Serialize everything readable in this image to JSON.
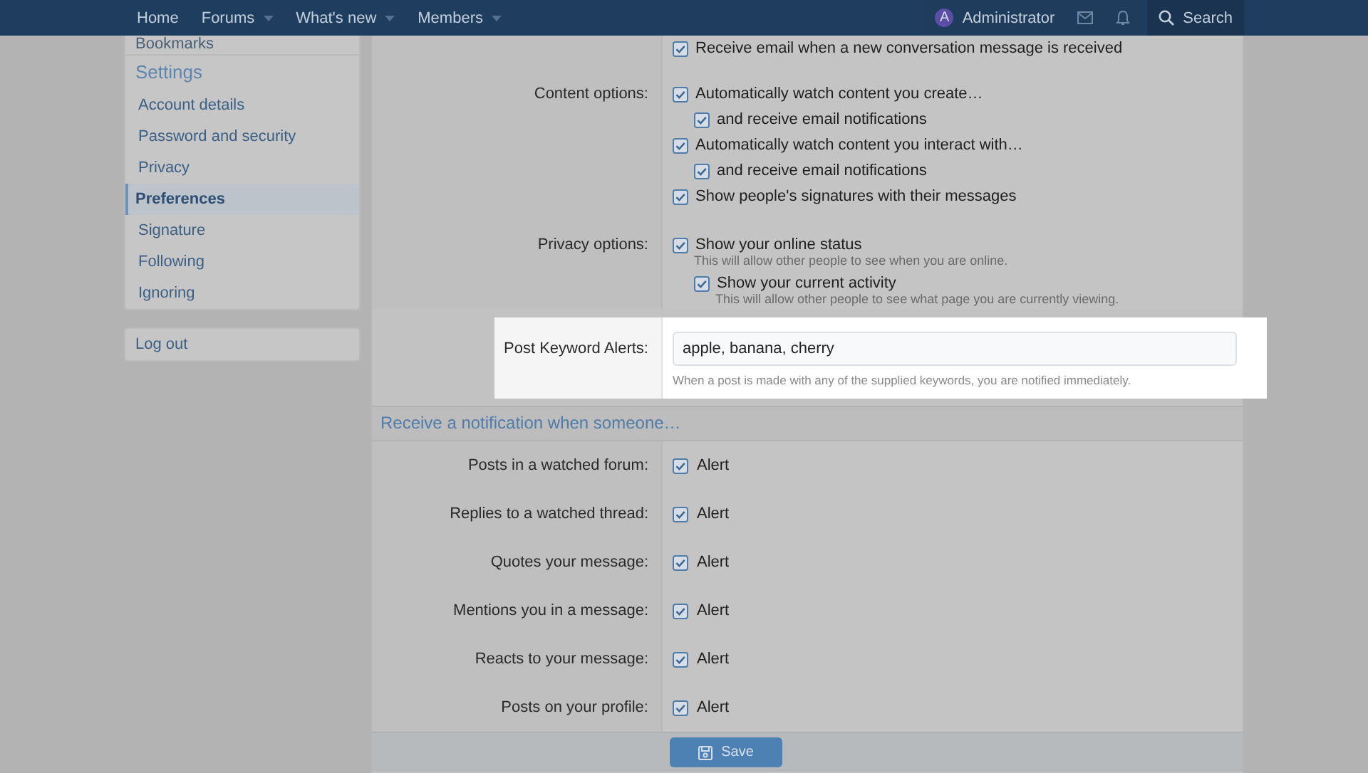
{
  "navbar": {
    "items": [
      {
        "label": "Home",
        "dropdown": false
      },
      {
        "label": "Forums",
        "dropdown": true
      },
      {
        "label": "What's new",
        "dropdown": true
      },
      {
        "label": "Members",
        "dropdown": true
      }
    ],
    "user": {
      "initial": "A",
      "name": "Administrator"
    },
    "search": "Search"
  },
  "sidebar": {
    "cut_item": "Bookmarks",
    "section_title": "Settings",
    "items": [
      {
        "label": "Account details",
        "selected": false
      },
      {
        "label": "Password and security",
        "selected": false
      },
      {
        "label": "Privacy",
        "selected": false
      },
      {
        "label": "Preferences",
        "selected": true
      },
      {
        "label": "Signature",
        "selected": false
      },
      {
        "label": "Following",
        "selected": false
      },
      {
        "label": "Ignoring",
        "selected": false
      }
    ],
    "logout": "Log out"
  },
  "preferences": {
    "top_option": {
      "label": "Receive email when a new conversation message is received",
      "checked": true
    },
    "groups": [
      {
        "label": "Content options:",
        "options": [
          {
            "label": "Automatically watch content you create…",
            "checked": true,
            "children": [
              {
                "label": "and receive email notifications",
                "checked": true
              }
            ]
          },
          {
            "label": "Automatically watch content you interact with…",
            "checked": true,
            "children": [
              {
                "label": "and receive email notifications",
                "checked": true
              }
            ]
          },
          {
            "label": "Show people's signatures with their messages",
            "checked": true
          }
        ]
      },
      {
        "label": "Privacy options:",
        "options": [
          {
            "label": "Show your online status",
            "checked": true,
            "hint": "This will allow other people to see when you are online.",
            "children": [
              {
                "label": "Show your current activity",
                "checked": true,
                "hint": "This will allow other people to see what page you are currently viewing."
              }
            ]
          }
        ]
      }
    ],
    "keyword_alerts": {
      "label": "Post Keyword Alerts:",
      "value": "apple, banana, cherry",
      "hint": "When a post is made with any of the supplied keywords, you are notified immediately."
    },
    "notify_title": "Receive a notification when someone…",
    "notify_rows": [
      {
        "label": "Posts in a watched forum:",
        "option": "Alert",
        "checked": true
      },
      {
        "label": "Replies to a watched thread:",
        "option": "Alert",
        "checked": true
      },
      {
        "label": "Quotes your message:",
        "option": "Alert",
        "checked": true
      },
      {
        "label": "Mentions you in a message:",
        "option": "Alert",
        "checked": true
      },
      {
        "label": "Reacts to your message:",
        "option": "Alert",
        "checked": true
      },
      {
        "label": "Posts on your profile:",
        "option": "Alert",
        "checked": true
      }
    ],
    "save": "Save"
  }
}
